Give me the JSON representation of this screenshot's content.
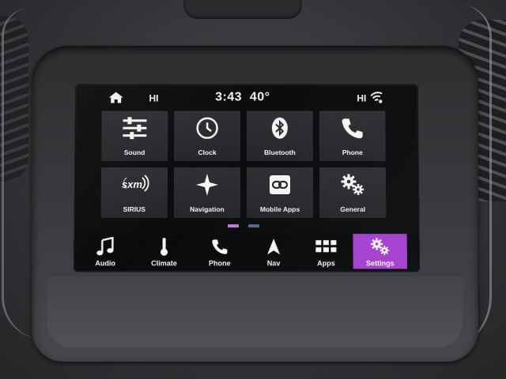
{
  "status": {
    "left_temp": "HI",
    "time": "3:43",
    "outside_temp": "40°",
    "right_temp": "HI"
  },
  "tiles": [
    {
      "label": "Sound",
      "icon": "sliders-icon"
    },
    {
      "label": "Clock",
      "icon": "clock-icon"
    },
    {
      "label": "Bluetooth",
      "icon": "bluetooth-icon"
    },
    {
      "label": "Phone",
      "icon": "phone-icon"
    },
    {
      "label": "SIRIUS",
      "icon": "sxm-logo-icon",
      "logo_text": "sxm"
    },
    {
      "label": "Navigation",
      "icon": "compass-star-icon"
    },
    {
      "label": "Mobile Apps",
      "icon": "link-icon"
    },
    {
      "label": "General",
      "icon": "gears-icon"
    }
  ],
  "pager": {
    "page": 1,
    "pages": 2,
    "active_color": "#c77be0",
    "inactive_color": "#5a6a86"
  },
  "nav": [
    {
      "label": "Audio",
      "icon": "music-note-icon",
      "active": false
    },
    {
      "label": "Climate",
      "icon": "thermometer-icon",
      "active": false
    },
    {
      "label": "Phone",
      "icon": "phone-icon",
      "active": false
    },
    {
      "label": "Nav",
      "icon": "nav-arrow-icon",
      "active": false
    },
    {
      "label": "Apps",
      "icon": "app-grid-icon",
      "active": false
    },
    {
      "label": "Settings",
      "icon": "gears-icon",
      "active": true
    }
  ],
  "colors": {
    "accent": "#a43fd0",
    "tile": "#2b2c2f",
    "screen": "#0c0d0f"
  }
}
